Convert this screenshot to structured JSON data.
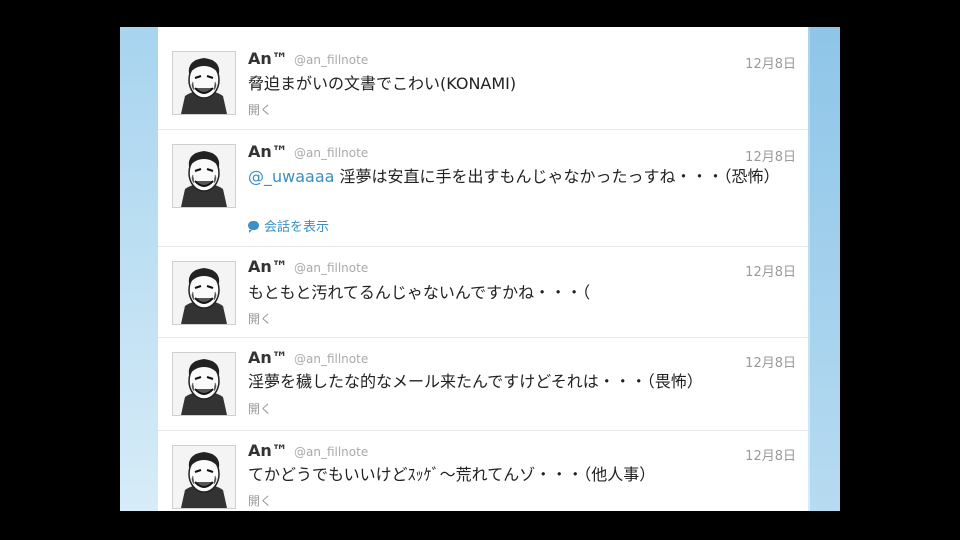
{
  "tweets": [
    {
      "name": "An™",
      "handle": "@an_fillnote",
      "date": "12月8日",
      "mention": "",
      "text": "脅迫まがいの文書でこわい(KONAMI)",
      "action": "開く"
    },
    {
      "name": "An™",
      "handle": "@an_fillnote",
      "date": "12月8日",
      "mention": "@_uwaaaa",
      "text": " 淫夢は安直に手を出すもんじゃなかったっすね・・・（恐怖）",
      "action": "会話を表示"
    },
    {
      "name": "An™",
      "handle": "@an_fillnote",
      "date": "12月8日",
      "mention": "",
      "text": "もともと汚れてるんじゃないんですかね・・・（",
      "action": "開く"
    },
    {
      "name": "An™",
      "handle": "@an_fillnote",
      "date": "12月8日",
      "mention": "",
      "text": "淫夢を穢したな的なメール来たんですけどそれは・・・（畏怖）",
      "action": "開く"
    },
    {
      "name": "An™",
      "handle": "@an_fillnote",
      "date": "12月8日",
      "mention": "",
      "text": "てかどうでもいいけどｽｯｹﾞ～荒れてんゾ・・・（他人事）",
      "action": "開く"
    }
  ],
  "colors": {
    "link": "#3b8fc4",
    "background": "#a8d4ef"
  }
}
